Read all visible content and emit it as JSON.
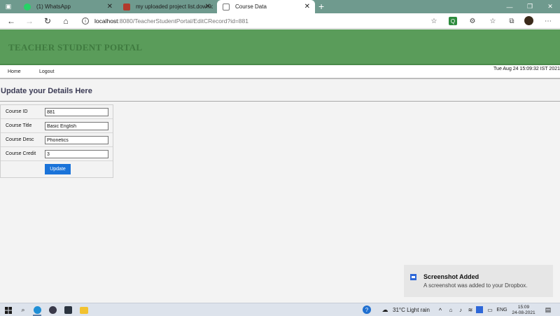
{
  "browser": {
    "tabs": [
      {
        "title": "(1) WhatsApp",
        "active": false,
        "color": "#25d366"
      },
      {
        "title": "my uploaded project list.downlo",
        "active": false,
        "color": "#c0392b"
      },
      {
        "title": "Course Data",
        "active": true,
        "color": "#ffffff"
      }
    ],
    "close_glyph": "✕",
    "newtab_glyph": "+",
    "url_host": "localhost",
    "url_rest": ":8080/TeacherStudentPortal/EditCRecord?id=881"
  },
  "page": {
    "banner_title": "TEACHER STUDENT PORTAL",
    "nav": {
      "home": "Home",
      "logout": "Logout"
    },
    "datetime": "Tue Aug 24 15:09:32 IST 2021",
    "heading": "Update your Details Here",
    "form": {
      "fields": [
        {
          "label": "Course ID",
          "value": "881"
        },
        {
          "label": "Course Title",
          "value": "Basic English"
        },
        {
          "label": "Course Desc",
          "value": "Phonetics"
        },
        {
          "label": "Course Credit",
          "value": "3"
        }
      ],
      "submit_label": "Update"
    }
  },
  "toast": {
    "title": "Screenshot Added",
    "message": "A screenshot was added to your Dropbox."
  },
  "taskbar": {
    "weather": "31°C  Light rain",
    "lang": "ENG",
    "time": "15:09",
    "date": "24-08-2021"
  }
}
